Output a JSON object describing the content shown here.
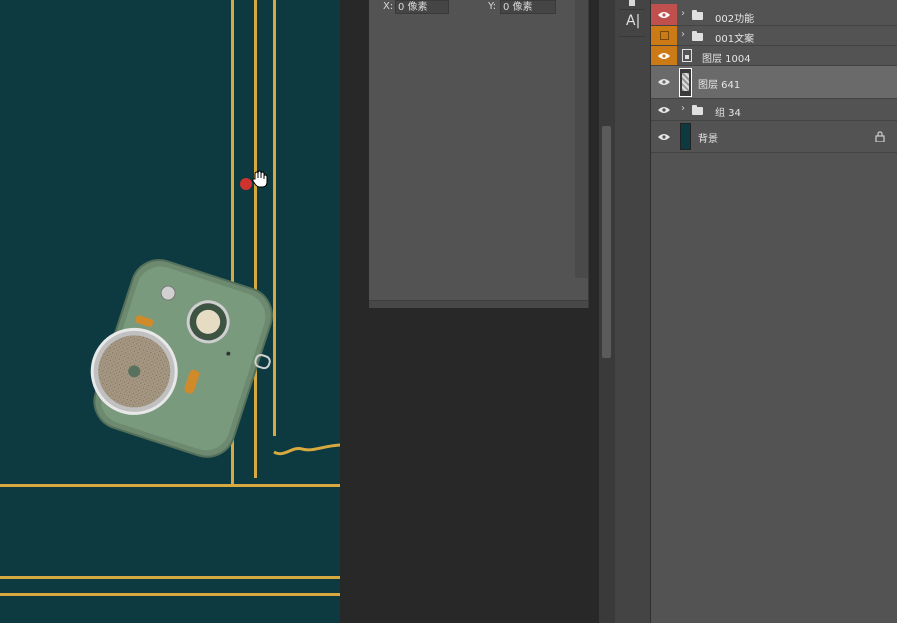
{
  "transform": {
    "x_label": "X:",
    "x_value": "0 像素",
    "y_label": "Y:",
    "y_value": "0 像素"
  },
  "tools": {
    "type_tool_glyph": "A|"
  },
  "layers": [
    {
      "name": "002功能",
      "kind": "group",
      "eye_color": "red",
      "selected": false,
      "collapsed": true
    },
    {
      "name": "001文案",
      "kind": "group",
      "eye_color": "orange",
      "visible": false,
      "collapsed": true
    },
    {
      "name": "图层 1004",
      "kind": "smart-object",
      "eye_color": "orange",
      "selected": false
    },
    {
      "name": "图层 641",
      "kind": "pixel",
      "selected": true
    },
    {
      "name": "组 34",
      "kind": "group",
      "collapsed": true
    },
    {
      "name": "背景",
      "kind": "background",
      "locked": true
    }
  ],
  "colors": {
    "canvas_bg": "#0c3a40",
    "gold_lines": "#d8a93e",
    "eye_red": "#c0504d",
    "eye_orange": "#cc7a15",
    "layer_selected": "#6a6a6a",
    "panel_bg": "#535353"
  }
}
